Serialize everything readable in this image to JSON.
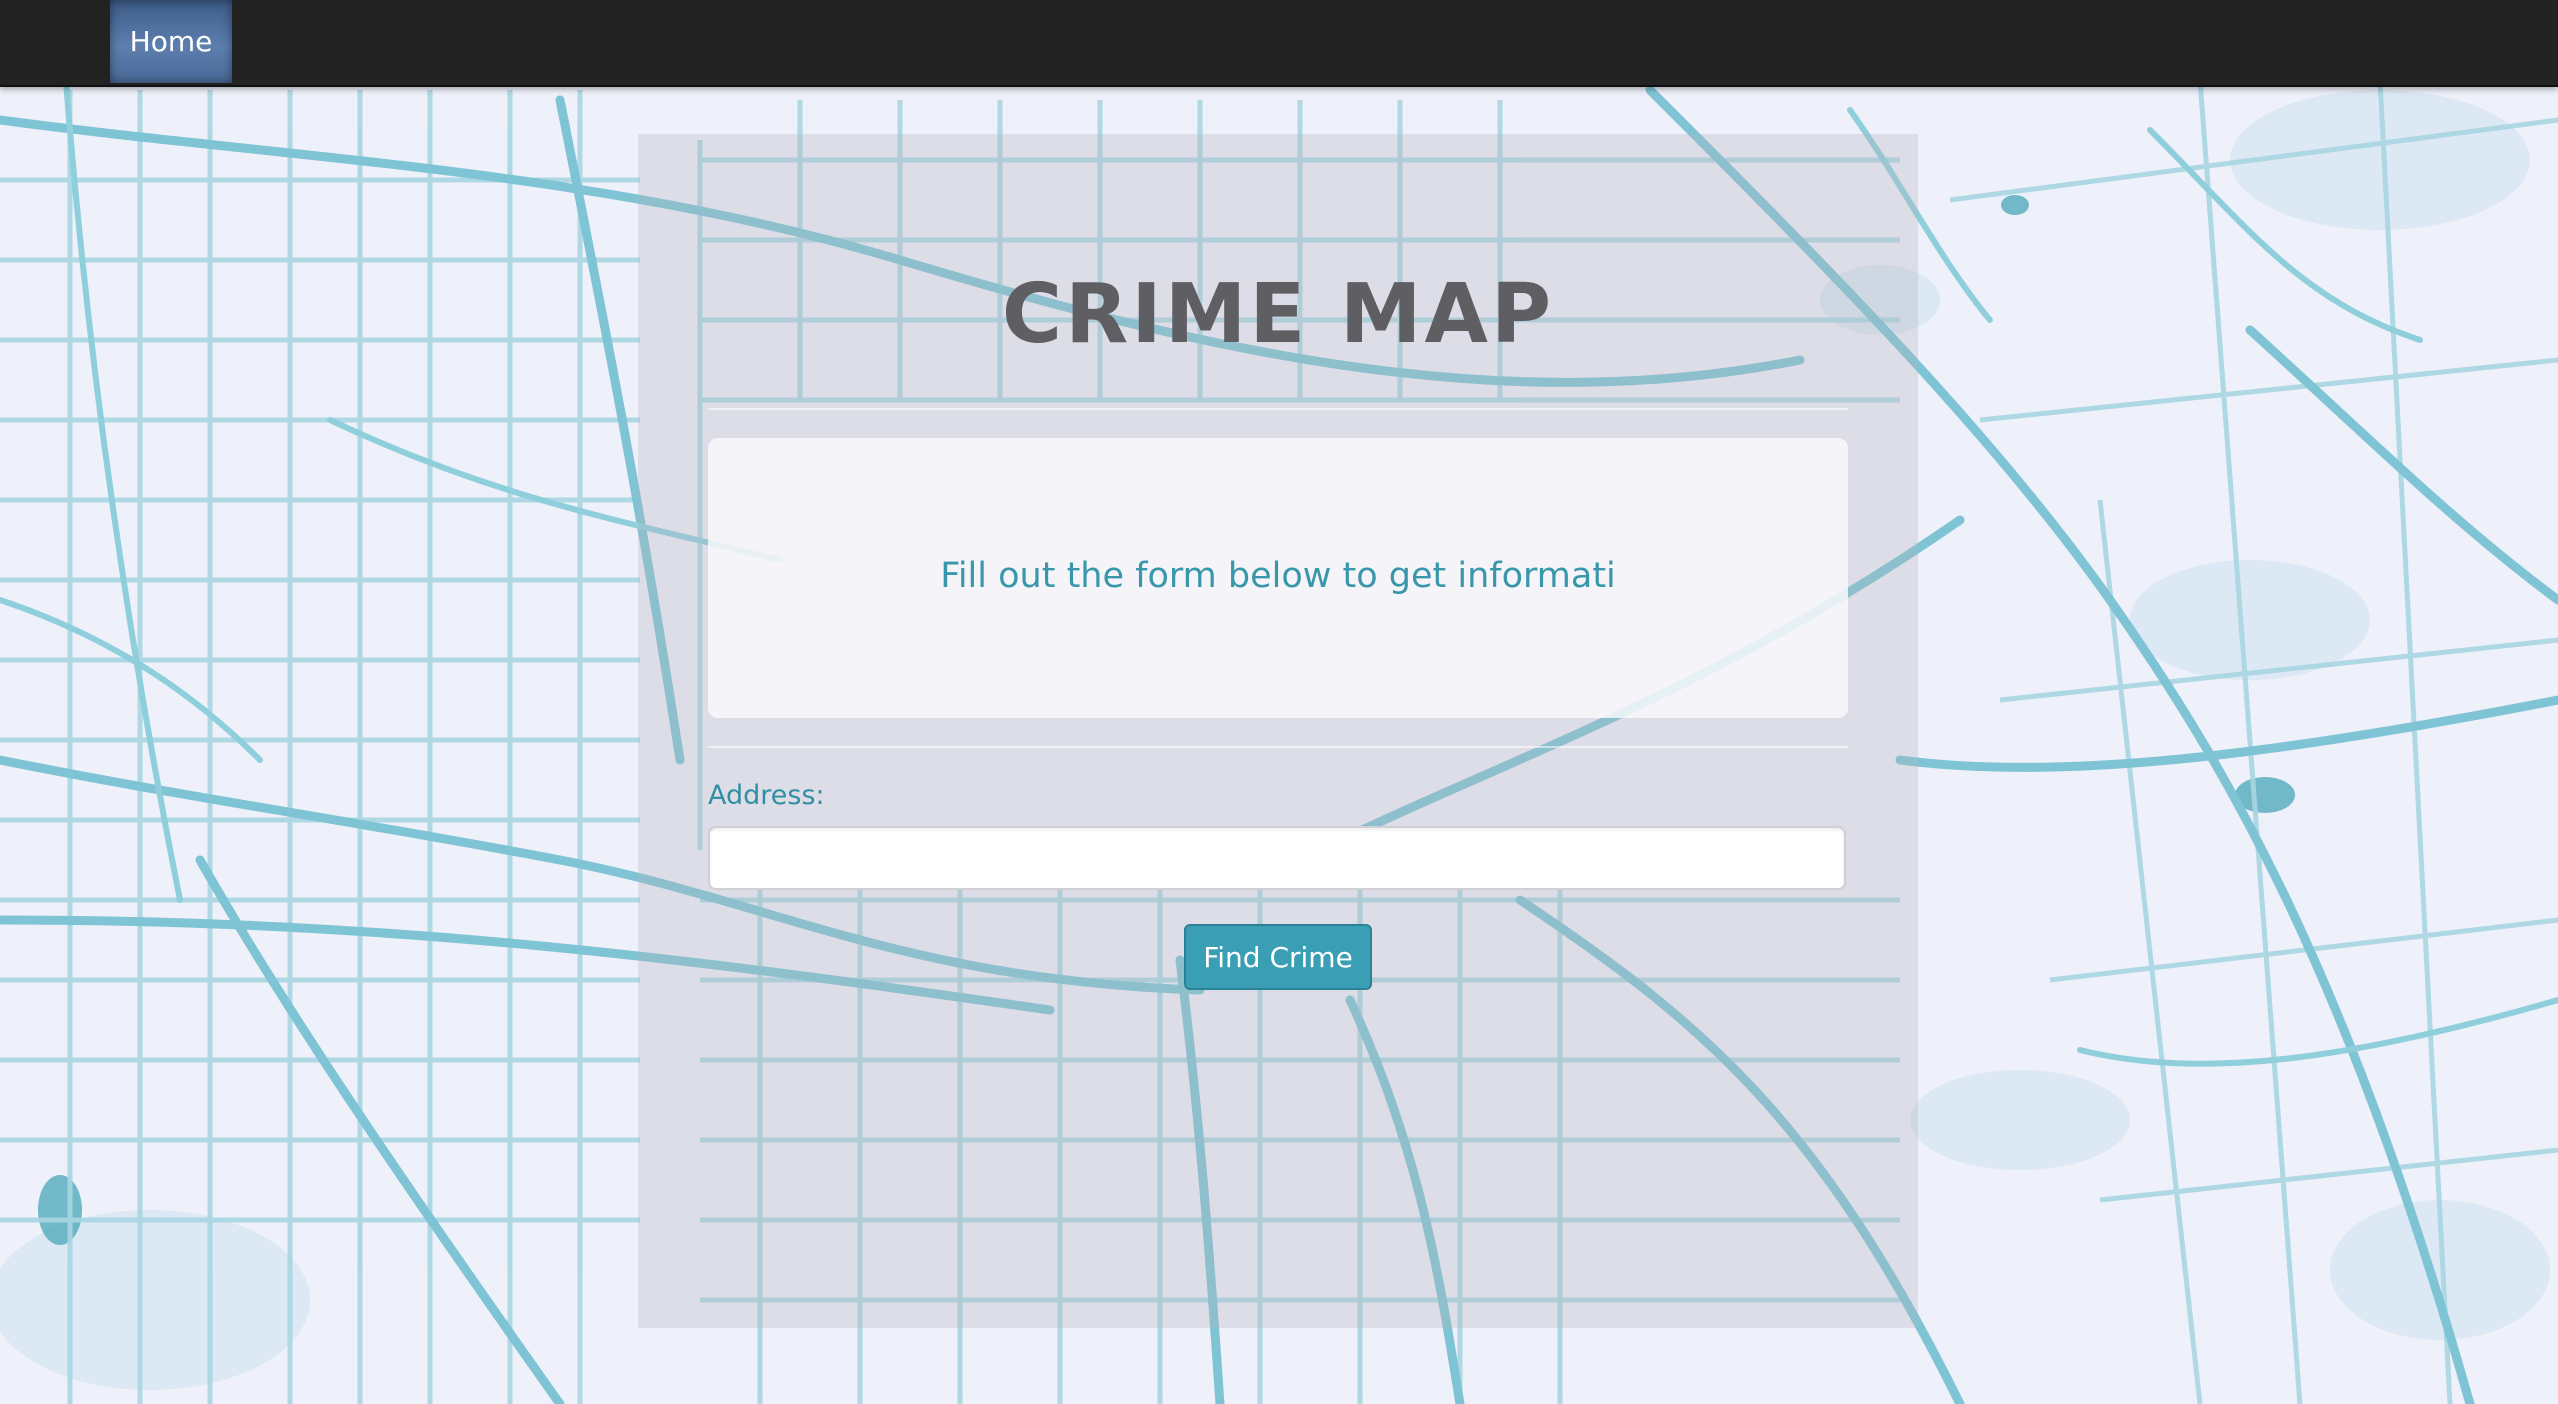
{
  "navbar": {
    "home_label": "Home"
  },
  "main": {
    "title": "CRIME MAP",
    "jumbotron_text": "Fill out the form below to get informati",
    "address_label": "Address:",
    "address_value": "",
    "find_button_label": "Find Crime"
  },
  "colors": {
    "navbar_bg": "#222222",
    "nav_active_bg": "#4a6a98",
    "accent": "#3a9fb5",
    "title": "#5f5f63",
    "map_roads": "#8ccbd8",
    "map_land": "#eef0fa"
  }
}
